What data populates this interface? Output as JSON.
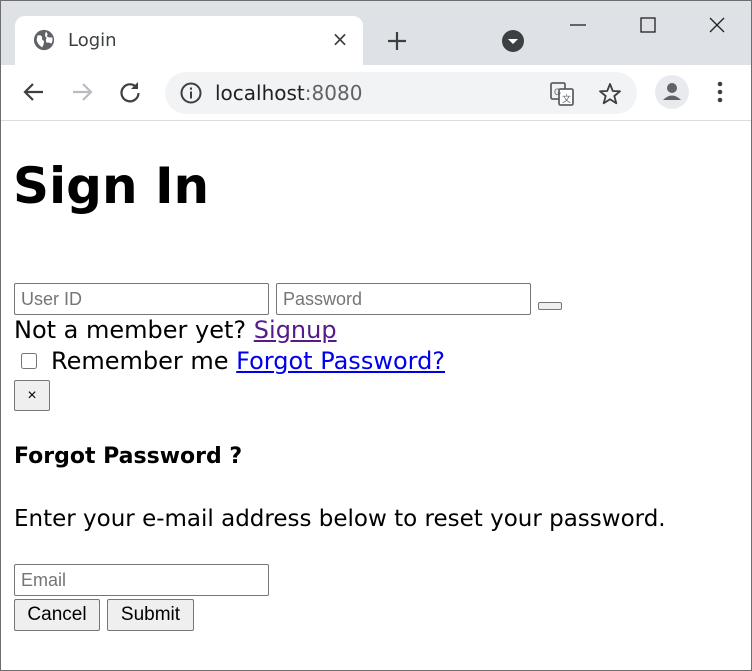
{
  "browser": {
    "tab": {
      "title": "Login",
      "favicon": "globe-icon",
      "close_label": "×"
    },
    "address": {
      "host": "localhost",
      "port": ":8080"
    },
    "icons": [
      "back-icon",
      "forward-icon",
      "reload-icon",
      "info-icon",
      "translate-icon",
      "star-icon",
      "avatar",
      "menu-icon",
      "new-tab-icon",
      "tab-search-icon",
      "minimize-icon",
      "maximize-icon",
      "close-window-icon"
    ]
  },
  "login": {
    "title": "Sign In",
    "userid_placeholder": "User ID",
    "password_placeholder": "Password",
    "member_prompt": "Not a member yet?",
    "signup_label": "Signup",
    "remember_label": "Remember me",
    "forgot_label": "Forgot Password?",
    "remember_checked": false
  },
  "modal": {
    "close_label": "×",
    "title": "Forgot Password ?",
    "instructions": "Enter your e-mail address below to reset your password.",
    "email_placeholder": "Email",
    "cancel_label": "Cancel",
    "submit_label": "Submit"
  },
  "colors": {
    "link": "#0000ee",
    "visited_link": "#551a8b",
    "tabstrip": "#dee1e6",
    "omnibox": "#f1f3f4"
  }
}
